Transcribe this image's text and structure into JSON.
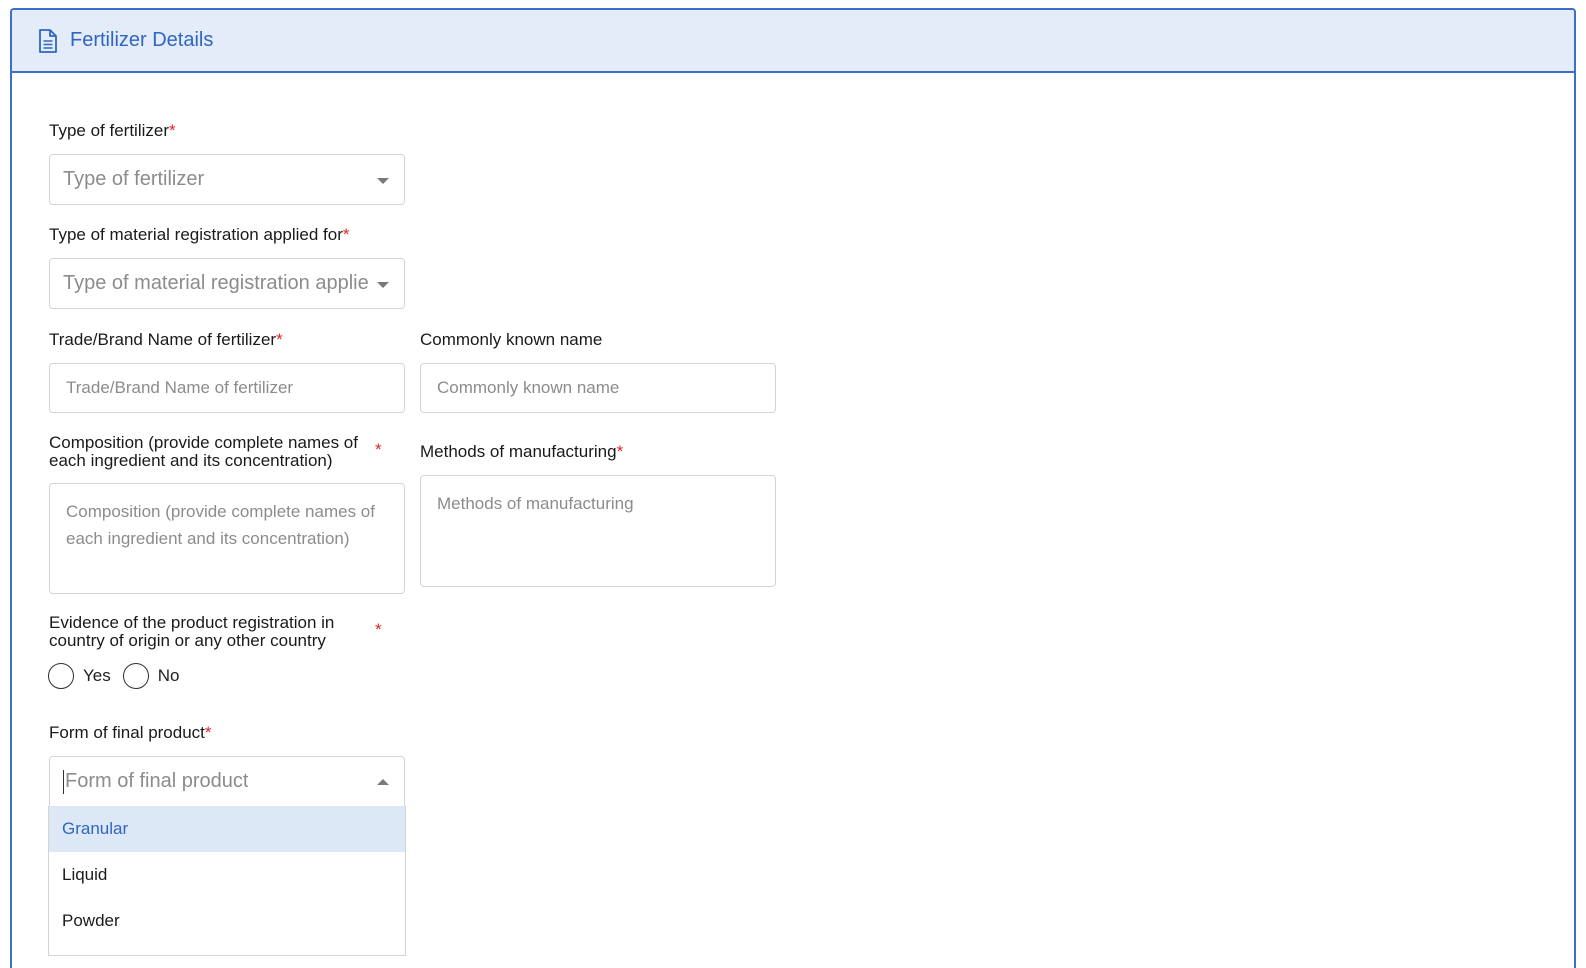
{
  "panel": {
    "title": "Fertilizer Details",
    "icon": "document-icon",
    "accent_color": "#3b6fc9",
    "header_bg": "#e3ecf8"
  },
  "form": {
    "required_mark": "*",
    "type_of_fertilizer": {
      "label": "Type of fertilizer",
      "placeholder": "Type of fertilizer"
    },
    "material_registration": {
      "label": "Type of material registration applied for",
      "placeholder": "Type of material registration applie"
    },
    "trade_brand_name": {
      "label": "Trade/Brand Name of fertilizer",
      "placeholder": "Trade/Brand Name of fertilizer"
    },
    "commonly_known_name": {
      "label": "Commonly known name",
      "placeholder": "Commonly known name"
    },
    "composition": {
      "label_line1": "Composition (provide complete names of",
      "label_line2": "each ingredient and its concentration)",
      "placeholder_line1": "Composition (provide complete names of",
      "placeholder_line2": "each ingredient and its concentration)"
    },
    "methods_of_manufacturing": {
      "label": "Methods of manufacturing",
      "placeholder": "Methods of manufacturing"
    },
    "evidence_registration": {
      "label_line1": "Evidence of the product registration in",
      "label_line2": "country of origin or any other country",
      "options": [
        "Yes",
        "No"
      ]
    },
    "form_of_final_product": {
      "label": "Form of final product",
      "placeholder": "Form of final product",
      "options": [
        "Granular",
        "Liquid",
        "Powder"
      ],
      "highlighted": "Granular"
    }
  }
}
